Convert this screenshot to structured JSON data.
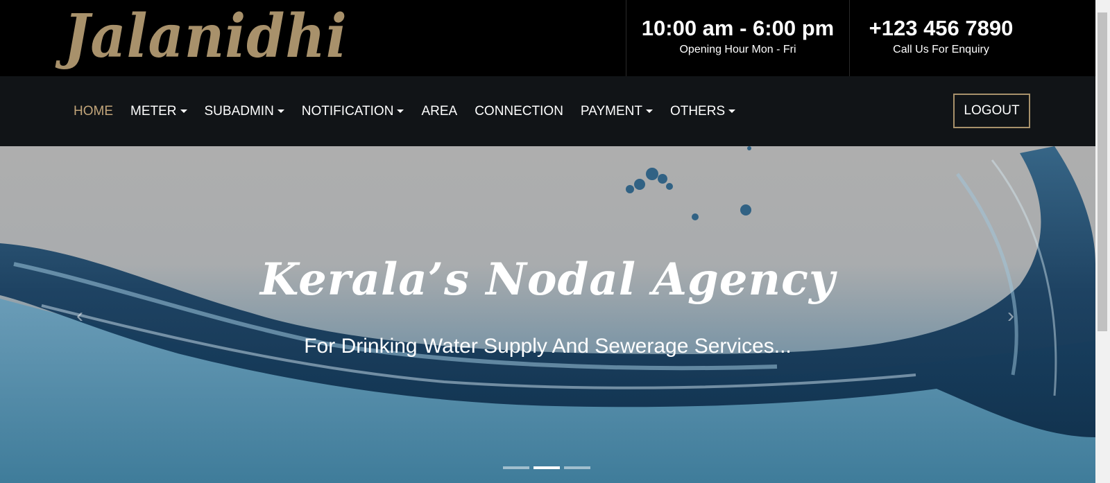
{
  "header": {
    "logo_text": "Jalanidhi",
    "hours": {
      "main": "10:00 am - 6:00 pm",
      "sub": "Opening Hour Mon - Fri"
    },
    "phone": {
      "main": "+123 456 7890",
      "sub": "Call Us For Enquiry"
    }
  },
  "nav": {
    "items": [
      {
        "label": "HOME",
        "dropdown": false,
        "active": true
      },
      {
        "label": "METER",
        "dropdown": true
      },
      {
        "label": "SUBADMIN",
        "dropdown": true
      },
      {
        "label": "NOTIFICATION",
        "dropdown": true
      },
      {
        "label": "AREA",
        "dropdown": false
      },
      {
        "label": "CONNECTION",
        "dropdown": false
      },
      {
        "label": "PAYMENT",
        "dropdown": true
      },
      {
        "label": "OTHERS",
        "dropdown": true
      }
    ],
    "logout_label": "LOGOUT"
  },
  "hero": {
    "title": "Kerala’s Nodal Agency",
    "subtitle": "For Drinking Water Supply And Sewerage Services...",
    "prev_icon": "‹",
    "next_icon": "›",
    "slides": 3,
    "active_slide": 2
  },
  "colors": {
    "accent": "#a8916b",
    "active_nav": "#c2a57a",
    "topbar_bg": "#000000",
    "navbar_bg": "#111417"
  }
}
